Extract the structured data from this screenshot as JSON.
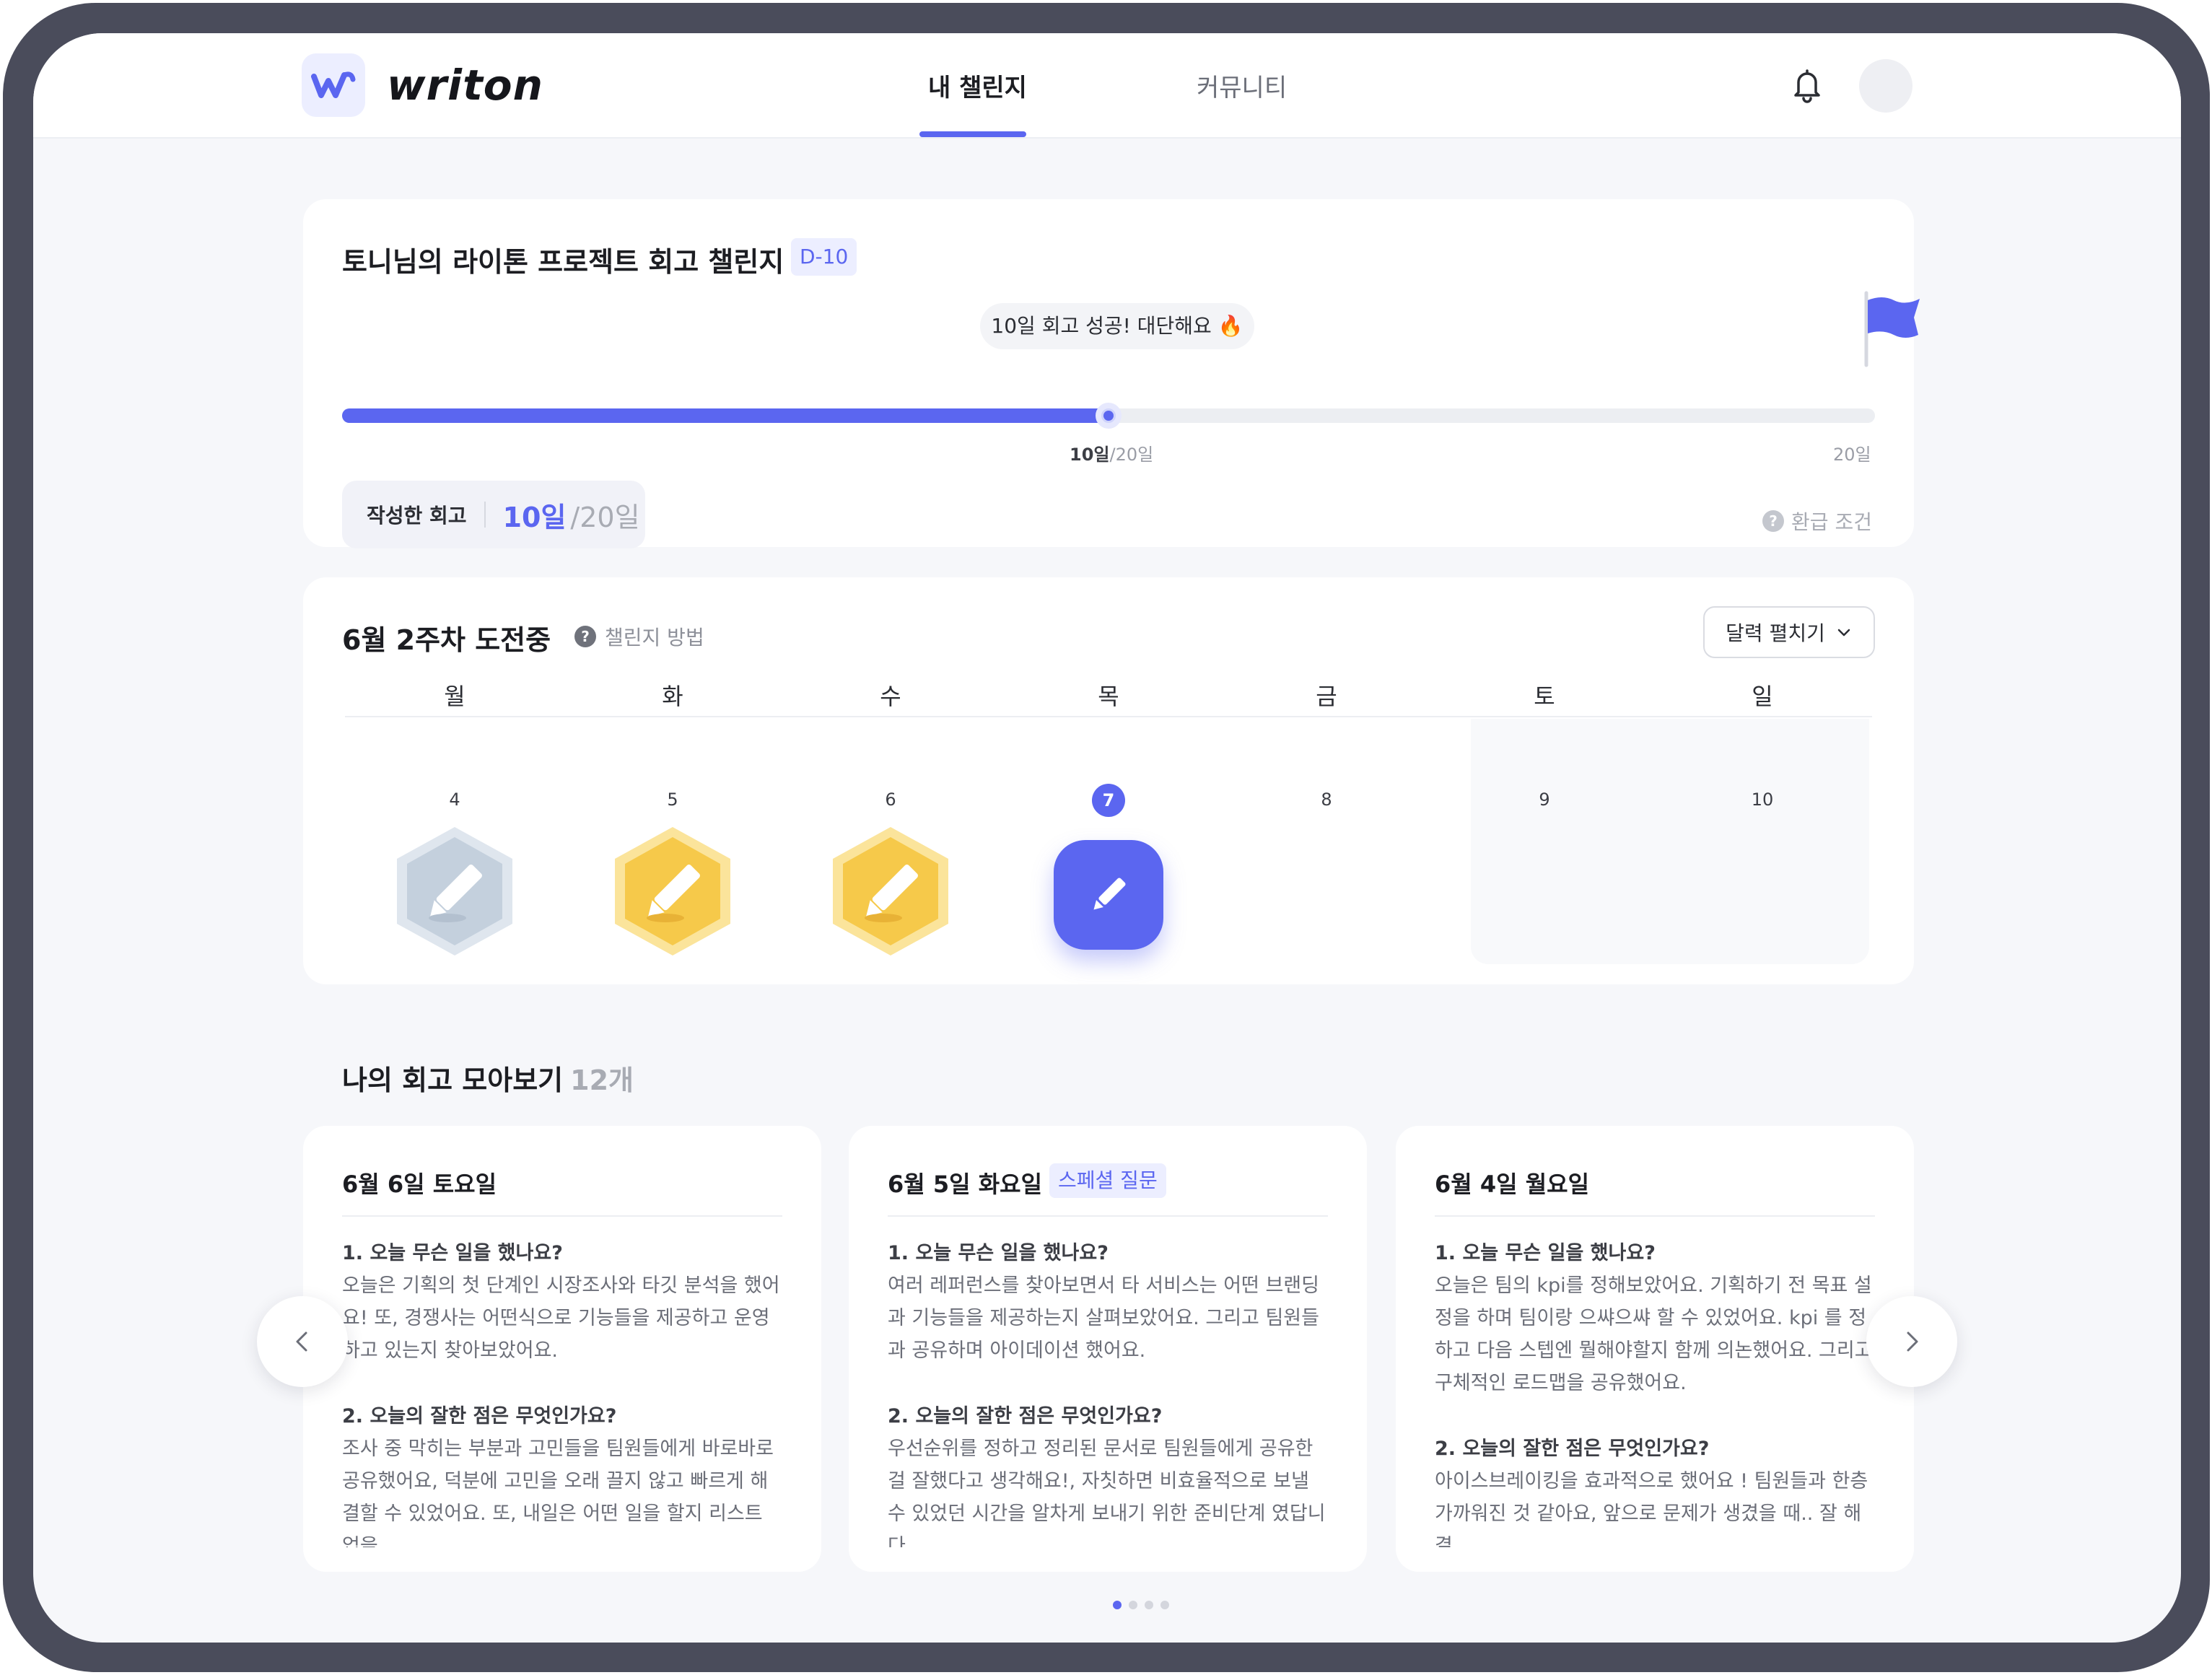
{
  "header": {
    "logo_text": "writon",
    "tabs": [
      {
        "label": "내 챌린지",
        "active": true
      },
      {
        "label": "커뮤니티",
        "active": false
      }
    ],
    "icons": {
      "notification": "bell-icon",
      "avatar": "avatar"
    }
  },
  "challenge": {
    "title": "토니님의 라이톤 프로젝트 회고 챌린지",
    "dday": "D-10",
    "bubble": "10일 회고 성공! 대단해요 🔥",
    "progress": {
      "done": 10,
      "total": 20,
      "fraction": 0.5
    },
    "current_label_bold": "10일",
    "current_label_rest": "/20일",
    "end_label": "20일",
    "written_label": "작성한 회고",
    "written_count": "10일",
    "written_total": "/20일",
    "refund_label": "환급 조건"
  },
  "week": {
    "title": "6월 2주차 도전중",
    "method_label": "챌린지 방법",
    "calendar_button": "달력 펼치기",
    "days": [
      {
        "weekday": "월",
        "date": "4",
        "status": "missed"
      },
      {
        "weekday": "화",
        "date": "5",
        "status": "done"
      },
      {
        "weekday": "수",
        "date": "6",
        "status": "done"
      },
      {
        "weekday": "목",
        "date": "7",
        "status": "today"
      },
      {
        "weekday": "금",
        "date": "8",
        "status": "upcoming"
      },
      {
        "weekday": "토",
        "date": "9",
        "status": "weekend"
      },
      {
        "weekday": "일",
        "date": "10",
        "status": "weekend"
      }
    ]
  },
  "reviews": {
    "title": "나의 회고 모아보기",
    "count": "12개",
    "items": [
      {
        "date": "6월 6일 토요일",
        "tag": "",
        "q1": "1. 오늘 무슨 일을 했나요?",
        "a1": "오늘은 기획의 첫 단계인 시장조사와 타깃 분석을 했어요! 또, 경쟁사는 어떤식으로 기능들을 제공하고 운영하고 있는지 찾아보았어요.",
        "q2": "2. 오늘의 잘한 점은 무엇인가요?",
        "a2": "조사 중 막히는 부분과 고민들을 팀원들에게 바로바로 공유했어요, 덕분에 고민을 오래 끌지 않고 빠르게 해결할 수 있었어요. 또, 내일은 어떤 일을 할지 리스트 업을"
      },
      {
        "date": "6월 5일 화요일",
        "tag": "스페셜 질문",
        "q1": "1. 오늘 무슨 일을 했나요?",
        "a1": "여러 레퍼런스를 찾아보면서 타 서비스는 어떤 브랜딩과 기능들을 제공하는지 살펴보았어요. 그리고 팀원들과 공유하며 아이데이션 했어요.",
        "q2": "2. 오늘의 잘한 점은 무엇인가요?",
        "a2": "우선순위를 정하고 정리된 문서로 팀원들에게 공유한걸 잘했다고 생각해요!, 자칫하면 비효율적으로 보낼 수 있었던 시간을 알차게 보내기 위한 준비단계 였답니다."
      },
      {
        "date": "6월 4일 월요일",
        "tag": "",
        "q1": "1. 오늘 무슨 일을 했나요?",
        "a1": "오늘은 팀의 kpi를 정해보았어요. 기획하기 전 목표 설정을 하며 팀이랑 으쌰으쌰 할 수 있었어요. kpi 를 정하고 다음 스텝엔 뭘해야할지 함께 의논했어요. 그리고 구체적인 로드맵을 공유했어요.",
        "q2": "2. 오늘의 잘한 점은 무엇인가요?",
        "a2": "아이스브레이킹을 효과적으로 했어요 ! 팀원들과 한층 가까워진 것 같아요, 앞으로 문제가 생겼을 때.. 잘 해결"
      }
    ],
    "pager": {
      "pages": 4,
      "active": 1
    }
  },
  "colors": {
    "accent": "#5b66f0",
    "gold": "#f6c94a",
    "silver": "#c9d3df"
  }
}
